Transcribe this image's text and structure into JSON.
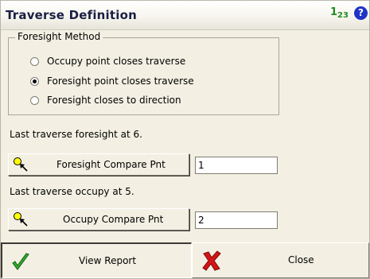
{
  "window": {
    "title": "Traverse Definition",
    "num_icon_main": "1",
    "num_icon_sub": "2",
    "num_icon_main2": "3",
    "help_icon": "?"
  },
  "foresight_method": {
    "legend": "Foresight Method",
    "options": [
      {
        "label": "Occupy point closes traverse",
        "selected": false
      },
      {
        "label": "Foresight point closes traverse",
        "selected": true
      },
      {
        "label": "Foresight closes to direction",
        "selected": false
      }
    ]
  },
  "foresight": {
    "status_text": "Last traverse foresight at 6.",
    "button_label": "Foresight Compare Pnt",
    "value": "1"
  },
  "occupy": {
    "status_text": "Last traverse occupy at 5.",
    "button_label": "Occupy Compare Pnt",
    "value": "2"
  },
  "footer": {
    "view_report_label": "View Report",
    "close_label": "Close"
  },
  "colors": {
    "title": "#1b1f44",
    "background": "#f3f0e3",
    "check_icon": "#2fae2f",
    "close_icon": "#d41515",
    "help_icon": "#1f33c7"
  }
}
